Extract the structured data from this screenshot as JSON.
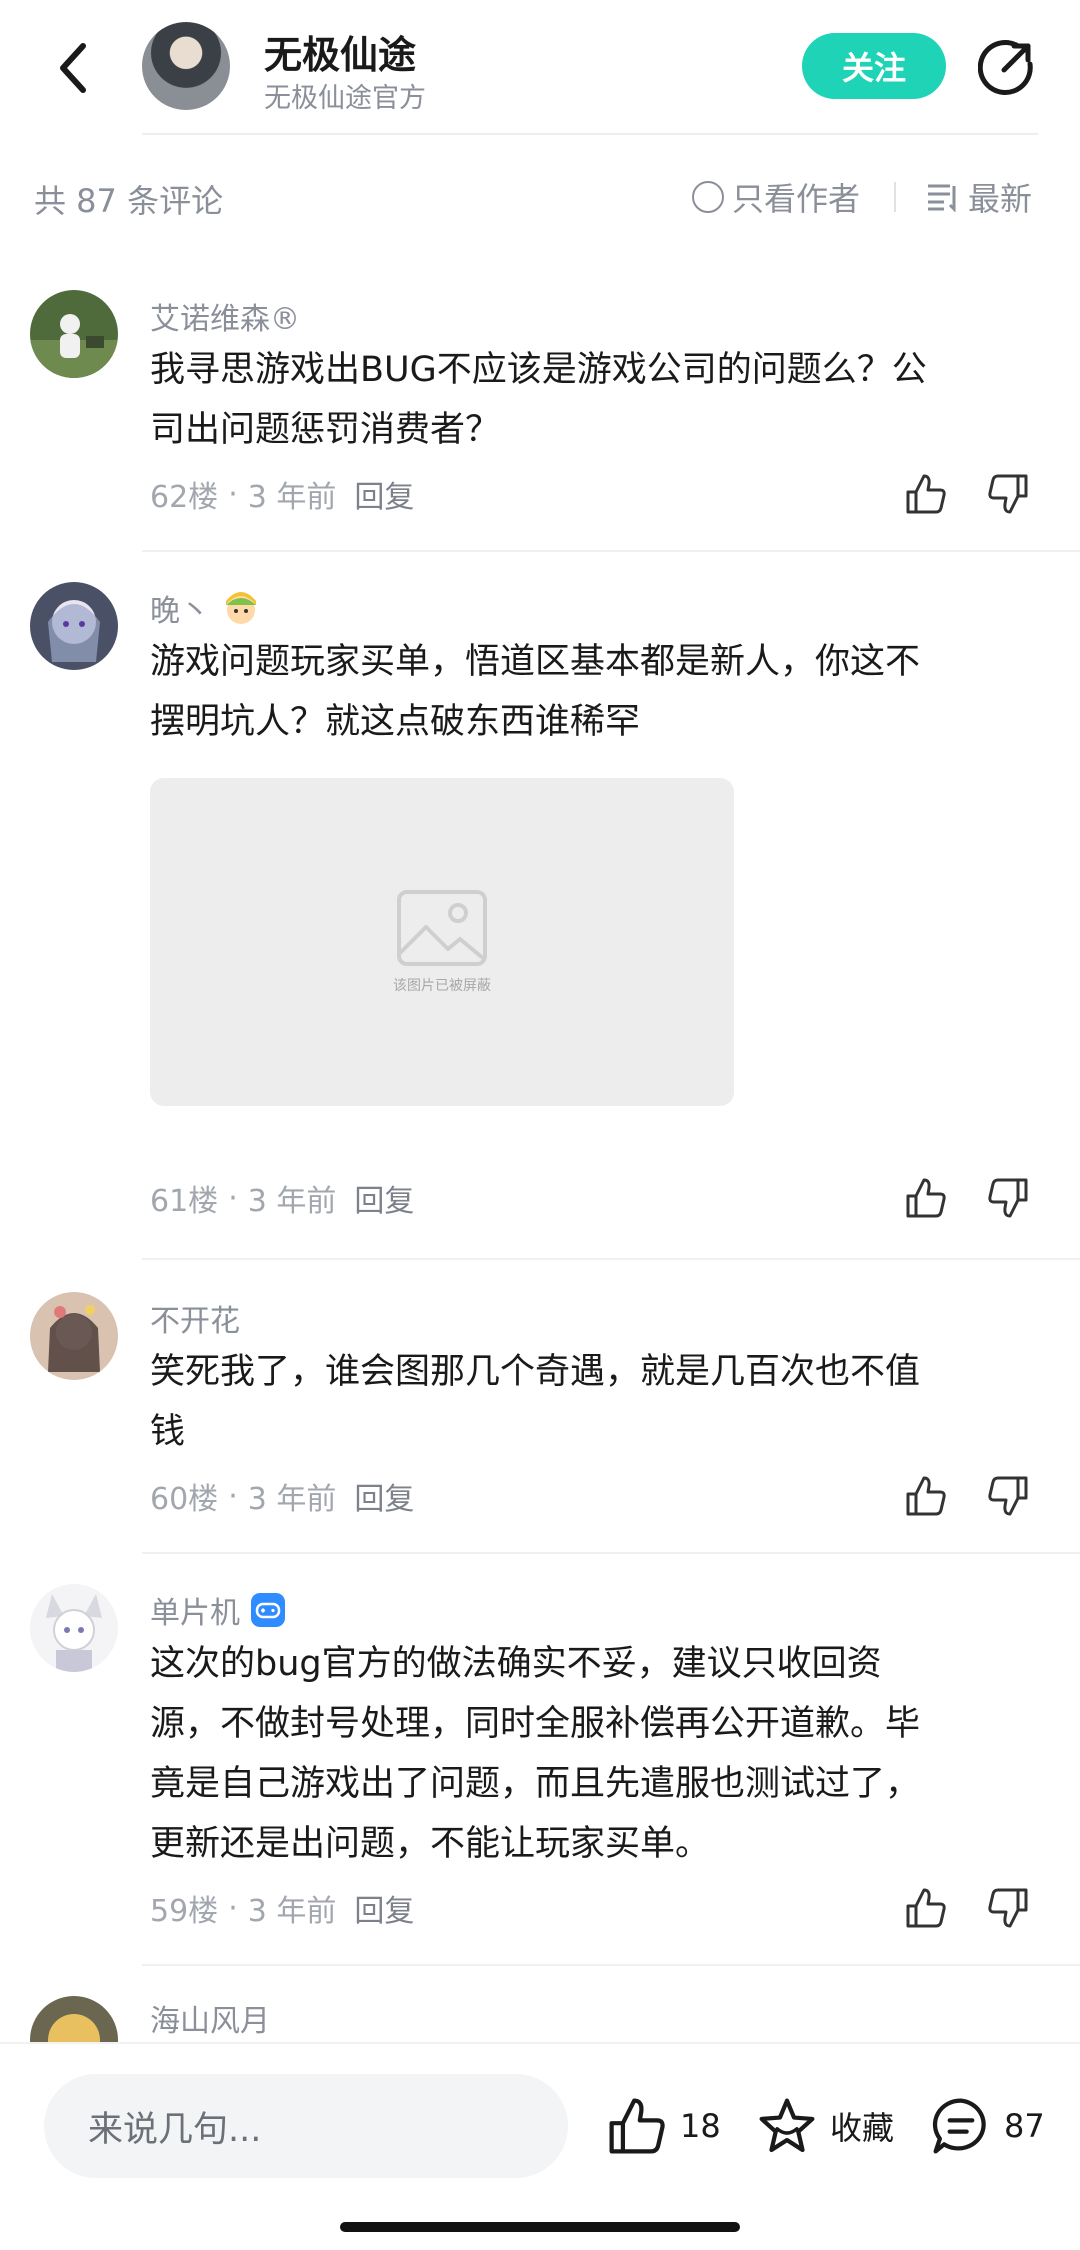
{
  "header": {
    "title": "无极仙途",
    "subtitle": "无极仙途官方",
    "follow_label": "关注"
  },
  "filter": {
    "count_text": "共 87 条评论",
    "author_only_label": "只看作者",
    "sort_label": "最新"
  },
  "comments": [
    {
      "name": "艾诺维森®",
      "text_lines": [
        "我寻思游戏出BUG不应该是游戏公司的问题么？公",
        "司出问题惩罚消费者？"
      ],
      "floor": "62楼",
      "time": "3 年前",
      "reply_label": "回复"
    },
    {
      "name": "晚丶",
      "badge": "avatar-emoji-icon",
      "text_lines": [
        "游戏问题玩家买单，悟道区基本都是新人，你这不",
        "摆明坑人？就这点破东西谁稀罕"
      ],
      "image_blocked_text": "该图片已被屏蔽",
      "floor": "61楼",
      "time": "3 年前",
      "reply_label": "回复"
    },
    {
      "name": "不开花",
      "text_lines": [
        "笑死我了，谁会图那几个奇遇，就是几百次也不值",
        "钱"
      ],
      "floor": "60楼",
      "time": "3 年前",
      "reply_label": "回复"
    },
    {
      "name": "单片机",
      "badge": "gamepad-badge-icon",
      "text_lines": [
        "这次的bug官方的做法确实不妥，建议只收回资",
        "源，不做封号处理，同时全服补偿再公开道歉。毕",
        "竟是自己游戏出了问题，而且先遣服也测试过了，",
        "更新还是出问题，不能让玩家买单。"
      ],
      "floor": "59楼",
      "time": "3 年前",
      "reply_label": "回复"
    },
    {
      "name": "海山风月"
    }
  ],
  "bottom_bar": {
    "input_placeholder": "来说几句...",
    "like_count": "18",
    "favorite_label": "收藏",
    "comment_count": "87"
  },
  "colors": {
    "accent": "#1fd3b6",
    "muted_text": "#8a8f99",
    "badge_blue": "#2f8cff"
  }
}
